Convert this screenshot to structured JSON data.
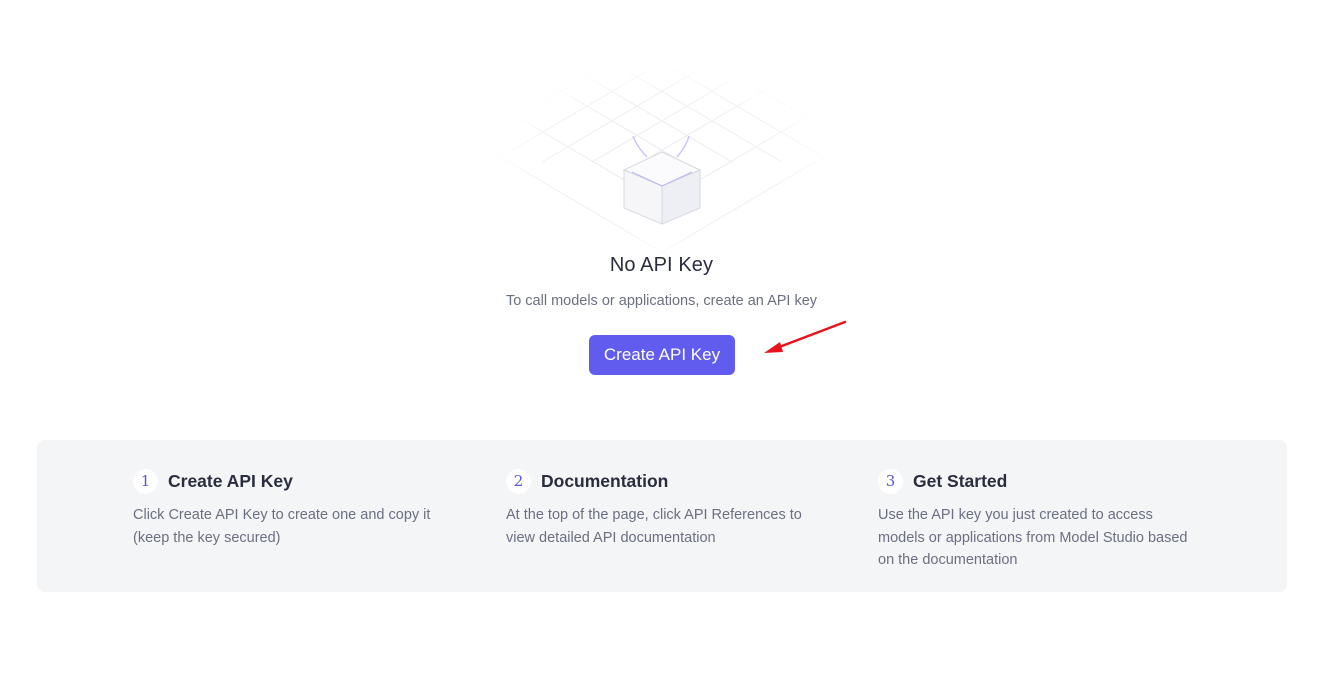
{
  "empty_state": {
    "title": "No API Key",
    "subtitle": "To call models or applications, create an API key",
    "create_button_label": "Create API Key"
  },
  "colors": {
    "primary": "#615ced",
    "annotation_arrow": "#e8131b",
    "panel_background": "#f4f5f7"
  },
  "steps": [
    {
      "number": "1",
      "title": "Create API Key",
      "description": "Click Create API Key to create one and copy it (keep the key secured)"
    },
    {
      "number": "2",
      "title": "Documentation",
      "description": "At the top of the page, click API References to view detailed API documentation"
    },
    {
      "number": "3",
      "title": "Get Started",
      "description": "Use the API key you just created to access models or applications from Model Studio based on the documentation"
    }
  ]
}
